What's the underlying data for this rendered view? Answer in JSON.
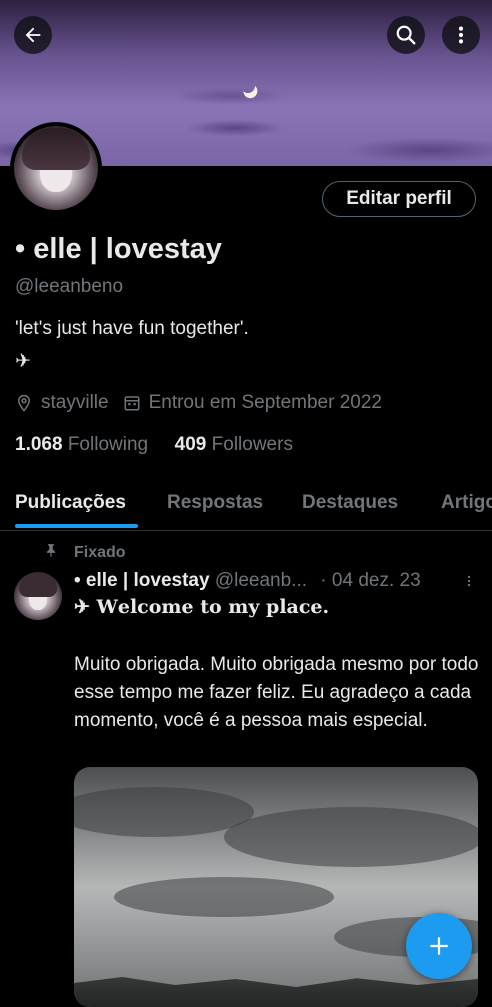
{
  "header": {
    "back_icon": "arrow-left-icon",
    "search_icon": "search-icon",
    "more_icon": "more-vertical-icon"
  },
  "profile": {
    "edit_button": "Editar perfil",
    "name": "• elle | lovestay",
    "handle": "@leeanbeno",
    "bio_line1": "'let's just have fun together'.",
    "bio_line2": "✈",
    "location": "stayville",
    "joined": "Entrou em September 2022",
    "following_count": "1.068",
    "following_label": "Following",
    "followers_count": "409",
    "followers_label": "Followers"
  },
  "tabs": [
    {
      "label": "Publicações",
      "active": true
    },
    {
      "label": "Respostas",
      "active": false
    },
    {
      "label": "Destaques",
      "active": false
    },
    {
      "label": "Artigos",
      "active": false
    }
  ],
  "post": {
    "pinned_label": "Fixado",
    "author_name": "• elle | lovestay",
    "author_handle": "@leeanb...",
    "date": "· 04 dez. 23",
    "title": "✈ 𝐖𝐞𝐥𝐜𝐨𝐦𝐞 𝐭𝐨 𝐦𝐲 𝐩𝐥𝐚𝐜𝐞.",
    "body": "Muito obrigada. Muito obrigada mesmo por todo esse tempo me fazer feliz. Eu agradeço a cada momento, você é a pessoa mais especial."
  },
  "fab": {
    "icon": "plus-icon"
  },
  "colors": {
    "accent": "#1d9bf0",
    "text": "#e7e9ea",
    "muted": "#71767b",
    "border": "#2f3336"
  }
}
